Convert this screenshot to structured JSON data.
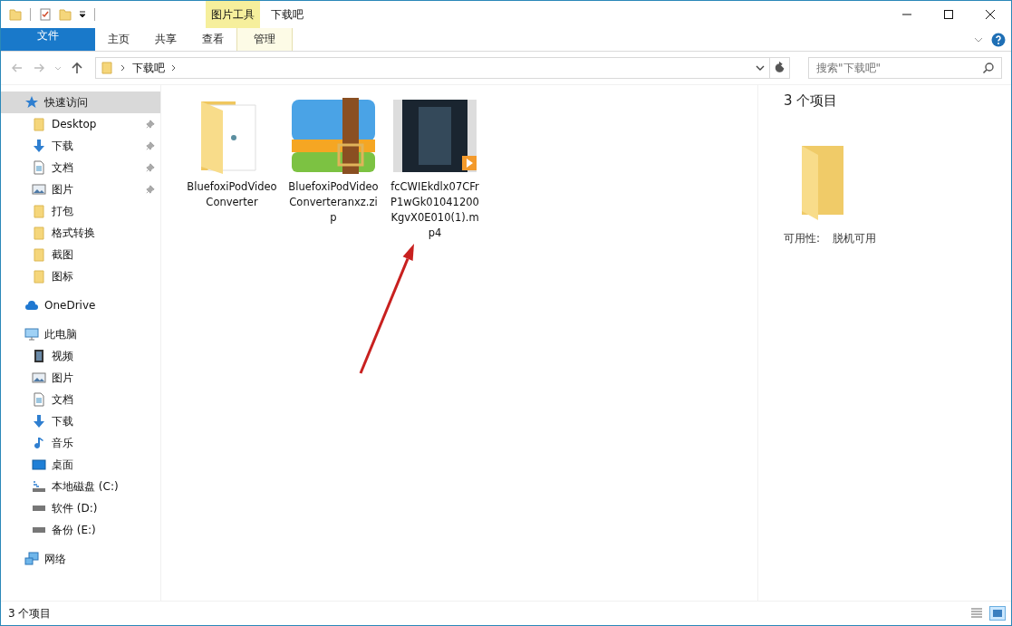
{
  "window": {
    "title": "下载吧",
    "context_tab": "图片工具"
  },
  "ribbon_tabs": [
    {
      "label": "文件",
      "kind": "file"
    },
    {
      "label": "主页",
      "kind": "normal"
    },
    {
      "label": "共享",
      "kind": "normal"
    },
    {
      "label": "查看",
      "kind": "normal"
    },
    {
      "label": "管理",
      "kind": "contextual"
    }
  ],
  "address_bar": {
    "path": [
      "下载吧"
    ],
    "search_placeholder": "搜索\"下载吧\""
  },
  "sidebar": [
    {
      "label": "快速访问",
      "kind": "star",
      "selected": true,
      "children": [
        {
          "label": "Desktop",
          "kind": "folder",
          "selected": false,
          "pinned": true
        },
        {
          "label": "下载",
          "kind": "download",
          "selected": false,
          "pinned": true
        },
        {
          "label": "文档",
          "kind": "document",
          "selected": false,
          "pinned": true
        },
        {
          "label": "图片",
          "kind": "picture",
          "selected": false,
          "pinned": true
        },
        {
          "label": "打包",
          "kind": "folder",
          "selected": false,
          "pinned": false
        },
        {
          "label": "格式转换",
          "kind": "folder",
          "selected": false,
          "pinned": false
        },
        {
          "label": "截图",
          "kind": "folder",
          "selected": false,
          "pinned": false
        },
        {
          "label": "图标",
          "kind": "folder",
          "selected": false,
          "pinned": false
        }
      ]
    },
    {
      "label": "OneDrive",
      "kind": "cloud",
      "selected": false
    },
    {
      "label": "此电脑",
      "kind": "pc",
      "selected": false,
      "children": [
        {
          "label": "视频",
          "kind": "video",
          "selected": false,
          "pinned": false
        },
        {
          "label": "图片",
          "kind": "picture",
          "selected": false,
          "pinned": false
        },
        {
          "label": "文档",
          "kind": "document",
          "selected": false,
          "pinned": false
        },
        {
          "label": "下载",
          "kind": "download",
          "selected": false,
          "pinned": false
        },
        {
          "label": "音乐",
          "kind": "music",
          "selected": false,
          "pinned": false
        },
        {
          "label": "桌面",
          "kind": "desktop",
          "selected": false,
          "pinned": false
        },
        {
          "label": "本地磁盘 (C:)",
          "kind": "system-drive",
          "selected": false,
          "pinned": false
        },
        {
          "label": "软件 (D:)",
          "kind": "drive",
          "selected": false,
          "pinned": false
        },
        {
          "label": "备份 (E:)",
          "kind": "drive",
          "selected": false,
          "pinned": false
        }
      ]
    },
    {
      "label": "网络",
      "kind": "network",
      "selected": false
    }
  ],
  "files": [
    {
      "name": "BluefoxiPodVideoConverter",
      "kind": "folder",
      "selected": false
    },
    {
      "name": "BluefoxiPodVideoConverteranxz.zip",
      "kind": "zip",
      "selected": false
    },
    {
      "name": "fcCWIEkdlx07CFrP1wGk01041200KgvX0E010(1).mp4",
      "kind": "video",
      "selected": false
    }
  ],
  "details_pane": {
    "count": "3 个项目",
    "property_label": "可用性:",
    "property_value": "脱机可用"
  },
  "status_bar": {
    "count": "3 个项目"
  }
}
